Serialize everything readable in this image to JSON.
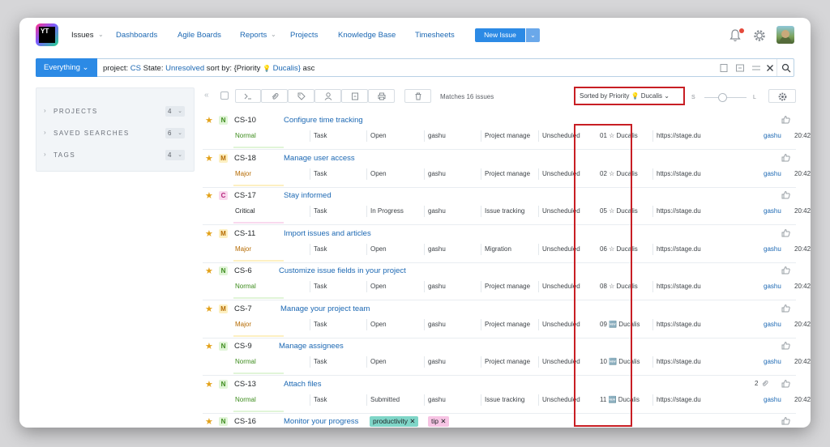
{
  "app": {
    "logo_text": "YT",
    "nav": [
      {
        "label": "Issues",
        "active": true
      },
      {
        "label": "Dashboards"
      },
      {
        "label": "Agile Boards"
      },
      {
        "label": "Reports"
      },
      {
        "label": "Projects"
      },
      {
        "label": "Knowledge Base"
      },
      {
        "label": "Timesheets"
      }
    ],
    "new_issue_label": "New Issue"
  },
  "search": {
    "context_label": "Everything",
    "query_parts": [
      {
        "text": "project: ",
        "kw": false
      },
      {
        "text": "CS",
        "kw": true
      },
      {
        "text": " State: ",
        "kw": false
      },
      {
        "text": "Unresolved",
        "kw": true
      },
      {
        "text": " sort by: {Priority ",
        "kw": false
      },
      {
        "text": "💡",
        "kw": false
      },
      {
        "text": " Ducalis}",
        "kw": true
      },
      {
        "text": " asc",
        "kw": false
      }
    ]
  },
  "sidebar": {
    "sections": [
      {
        "label": "PROJECTS",
        "count": "4"
      },
      {
        "label": "SAVED SEARCHES",
        "count": "6"
      },
      {
        "label": "TAGS",
        "count": "4"
      }
    ]
  },
  "toolbar": {
    "matches": "Matches 16 issues",
    "sorted_by": "Sorted by Priority 💡 Ducalis",
    "size_small": "S",
    "size_large": "L"
  },
  "colors": {
    "accent": "#2c8ae5",
    "link": "#1c68b3",
    "highlight_box": "#c81e24",
    "priority_normal_bg": "#e1f5d8",
    "priority_normal_fg": "#3d8c1d",
    "priority_major_bg": "#fdf0c2",
    "priority_major_fg": "#b56a00",
    "priority_critical_bg": "#f9d9ee",
    "priority_critical_fg": "#b4237b"
  },
  "issues": [
    {
      "id": "CS-10",
      "title": "Configure time tracking",
      "prio_letter": "N",
      "priority": "Normal",
      "type": "Task",
      "state": "Open",
      "assignee": "gashu",
      "subsystem": "Project manage",
      "sprint": "Unscheduled",
      "ducalis": "01 ☆ Ducalis",
      "link": "https://stage.du",
      "owner": "gashu",
      "time": "20:42",
      "attachments": ""
    },
    {
      "id": "CS-18",
      "title": "Manage user access",
      "prio_letter": "M",
      "priority": "Major",
      "type": "Task",
      "state": "Open",
      "assignee": "gashu",
      "subsystem": "Project manage",
      "sprint": "Unscheduled",
      "ducalis": "02 ☆ Ducalis",
      "link": "https://stage.du",
      "owner": "gashu",
      "time": "20:42",
      "attachments": ""
    },
    {
      "id": "CS-17",
      "title": "Stay informed",
      "prio_letter": "C",
      "priority": "Critical",
      "type": "Task",
      "state": "In Progress",
      "assignee": "gashu",
      "subsystem": "Issue tracking",
      "sprint": "Unscheduled",
      "ducalis": "05 ☆ Ducalis",
      "link": "https://stage.du",
      "owner": "gashu",
      "time": "20:42",
      "attachments": ""
    },
    {
      "id": "CS-11",
      "title": "Import issues and articles",
      "prio_letter": "M",
      "priority": "Major",
      "type": "Task",
      "state": "Open",
      "assignee": "gashu",
      "subsystem": "Migration",
      "sprint": "Unscheduled",
      "ducalis": "06 ☆ Ducalis",
      "link": "https://stage.du",
      "owner": "gashu",
      "time": "20:42",
      "attachments": ""
    },
    {
      "id": "CS-6",
      "title": "Customize issue fields in your project",
      "prio_letter": "N",
      "priority": "Normal",
      "type": "Task",
      "state": "Open",
      "assignee": "gashu",
      "subsystem": "Project manage",
      "sprint": "Unscheduled",
      "ducalis": "08 ☆ Ducalis",
      "link": "https://stage.du",
      "owner": "gashu",
      "time": "20:42",
      "attachments": ""
    },
    {
      "id": "CS-7",
      "title": "Manage your project team",
      "prio_letter": "M",
      "priority": "Major",
      "type": "Task",
      "state": "Open",
      "assignee": "gashu",
      "subsystem": "Project manage",
      "sprint": "Unscheduled",
      "ducalis": "09 🆕 Ducalis",
      "link": "https://stage.du",
      "owner": "gashu",
      "time": "20:42",
      "attachments": ""
    },
    {
      "id": "CS-9",
      "title": "Manage assignees",
      "prio_letter": "N",
      "priority": "Normal",
      "type": "Task",
      "state": "Open",
      "assignee": "gashu",
      "subsystem": "Project manage",
      "sprint": "Unscheduled",
      "ducalis": "10 🆕 Ducalis",
      "link": "https://stage.du",
      "owner": "gashu",
      "time": "20:42",
      "attachments": ""
    },
    {
      "id": "CS-13",
      "title": "Attach files",
      "prio_letter": "N",
      "priority": "Normal",
      "type": "Task",
      "state": "Submitted",
      "assignee": "gashu",
      "subsystem": "Issue tracking",
      "sprint": "Unscheduled",
      "ducalis": "11 🆕 Ducalis",
      "link": "https://stage.du",
      "owner": "gashu",
      "time": "20:42",
      "attachments": "2"
    },
    {
      "id": "CS-16",
      "title": "Monitor your progress",
      "prio_letter": "N",
      "priority": "",
      "type": "",
      "state": "",
      "assignee": "",
      "subsystem": "",
      "sprint": "",
      "ducalis": "",
      "link": "",
      "owner": "",
      "time": "",
      "attachments": "",
      "tags": [
        {
          "label": "productivity ✕",
          "bg": "#7fd6c8",
          "fg": "#1f2326"
        },
        {
          "label": "tip ✕",
          "bg": "#f7c4e4",
          "fg": "#1f2326"
        }
      ]
    }
  ]
}
